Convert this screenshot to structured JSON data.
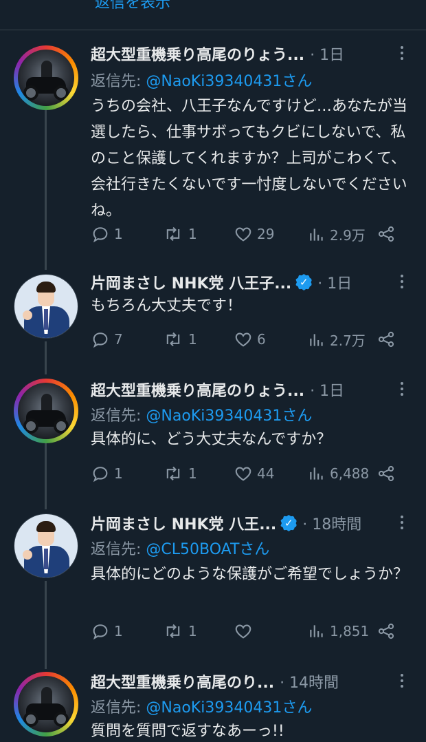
{
  "top_partial": "返信を表示",
  "tweets": [
    {
      "name": "超大型重機乗り高尾のりょう...",
      "time": "· 1日",
      "reply_prefix": "返信先: ",
      "reply_handle": "@NaoKi39340431さん",
      "text": "うちの会社、八王子なんですけど…あなたが当選したら、仕事サボってもクビにしないで、私のこと保護してくれますか？上司がこわくて、会社行きたくないです一忖度しないでくださいね。",
      "replies": "1",
      "retweets": "1",
      "likes": "29",
      "views": "2.9万"
    },
    {
      "name": "片岡まさし NHK党 八王子...",
      "time": "· 1日",
      "text": "もちろん大丈夫です！",
      "replies": "7",
      "retweets": "1",
      "likes": "6",
      "views": "2.7万"
    },
    {
      "name": "超大型重機乗り高尾のりょう...",
      "time": "· 1日",
      "reply_prefix": "返信先: ",
      "reply_handle": "@NaoKi39340431さん",
      "text": "具体的に、どう大丈夫なんですか？",
      "replies": "1",
      "retweets": "1",
      "likes": "44",
      "views": "6,488"
    },
    {
      "name": "片岡まさし NHK党 八王...",
      "time": "· 18時間",
      "reply_prefix": "返信先: ",
      "reply_handle": "@CL50BOATさん",
      "text": "具体的にどのような保護がご希望でしょうか？",
      "replies": "1",
      "retweets": "1",
      "likes": "",
      "views": "1,851"
    },
    {
      "name": "超大型重機乗り高尾のり...",
      "time": "· 14時間",
      "reply_prefix": "返信先: ",
      "reply_handle": "@NaoKi39340431さん",
      "text": "質問を質問で返すなあーっ!!"
    }
  ],
  "colors": {
    "background": "#15202b",
    "link": "#1d9bf0",
    "muted": "#8b98a5",
    "text": "#e7e9ea"
  }
}
